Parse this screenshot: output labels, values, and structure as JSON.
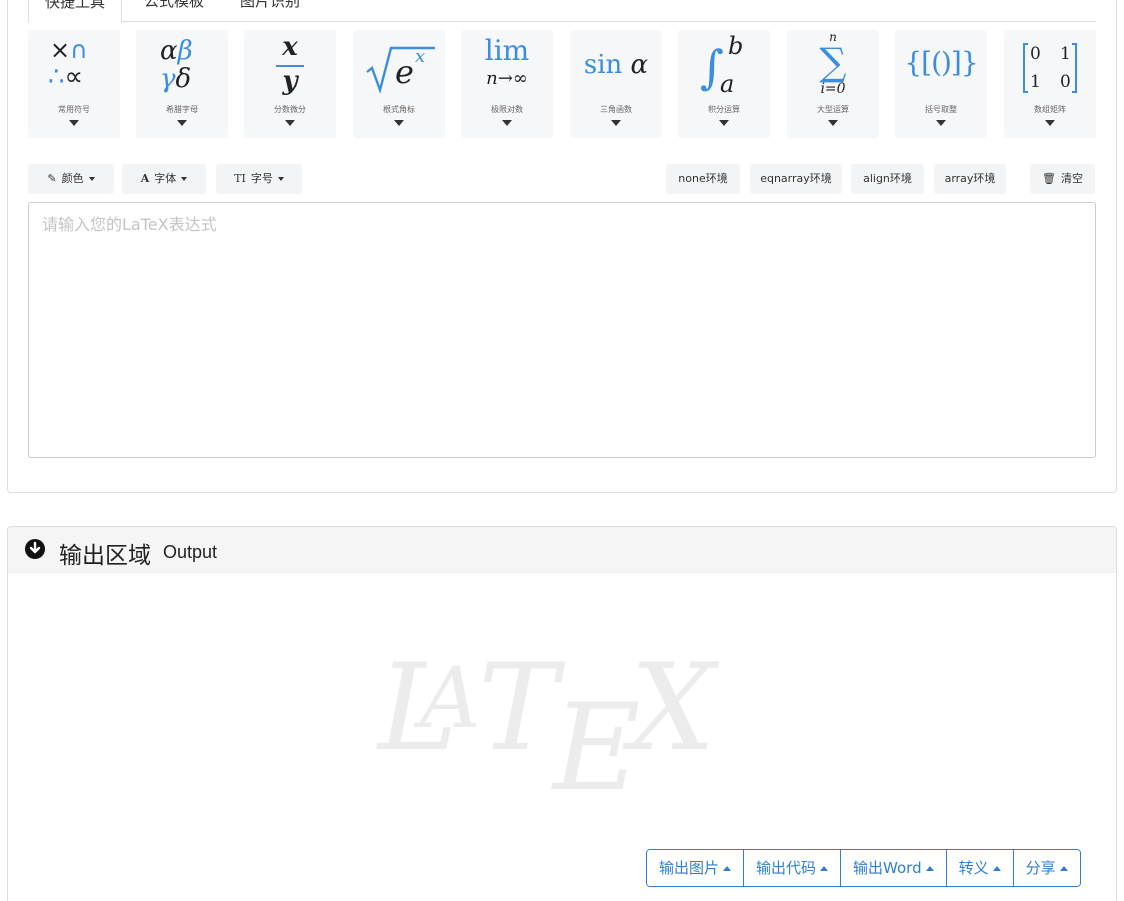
{
  "tabs": [
    {
      "label": "快捷工具"
    },
    {
      "label": "公式模板"
    },
    {
      "label": "图片识别"
    }
  ],
  "tools": [
    {
      "label": "常用符号",
      "icon": "common-symbols-icon"
    },
    {
      "label": "希腊字母",
      "icon": "greek-letters-icon"
    },
    {
      "label": "分数微分",
      "icon": "fraction-icon"
    },
    {
      "label": "根式角标",
      "icon": "radical-icon"
    },
    {
      "label": "极限对数",
      "icon": "limit-icon"
    },
    {
      "label": "三角函数",
      "icon": "trig-icon"
    },
    {
      "label": "积分运算",
      "icon": "integral-icon"
    },
    {
      "label": "大型运算",
      "icon": "sum-icon"
    },
    {
      "label": "括号取整",
      "icon": "brackets-icon"
    },
    {
      "label": "数组矩阵",
      "icon": "matrix-icon"
    }
  ],
  "glyphs": {
    "times": "×",
    "cap": "∩",
    "therefore": "∴",
    "propto": "∝",
    "alpha": "α",
    "beta": "β",
    "gamma": "γ",
    "delta": "δ",
    "x": "x",
    "y": "y",
    "e": "e",
    "lim": "lim",
    "lim_sub": "n→∞",
    "sin": "sin",
    "sin_arg": "α",
    "int": "∫",
    "b": "b",
    "a": "a",
    "n": "n",
    "sum": "∑",
    "sum_sub": "i=0",
    "brackets": "{[()]}",
    "m11": "0",
    "m12": "1",
    "m21": "1",
    "m22": "0"
  },
  "format_buttons": {
    "color": "颜色",
    "font": "字体",
    "size": "字号"
  },
  "env_buttons": {
    "none": "none环境",
    "eqnarray": "eqnarray环境",
    "align": "align环境",
    "array": "array环境",
    "clear": "清空"
  },
  "editor": {
    "placeholder": "请输入您的LaTeX表达式"
  },
  "output": {
    "title": "输出区域",
    "subtitle": "Output",
    "buttons": [
      "输出图片",
      "输出代码",
      "输出Word",
      "转义",
      "分享"
    ]
  },
  "colors": {
    "accent": "#2f7fcf",
    "math_blue": "#3a8de0",
    "tool_bg": "#f6f7f9"
  }
}
